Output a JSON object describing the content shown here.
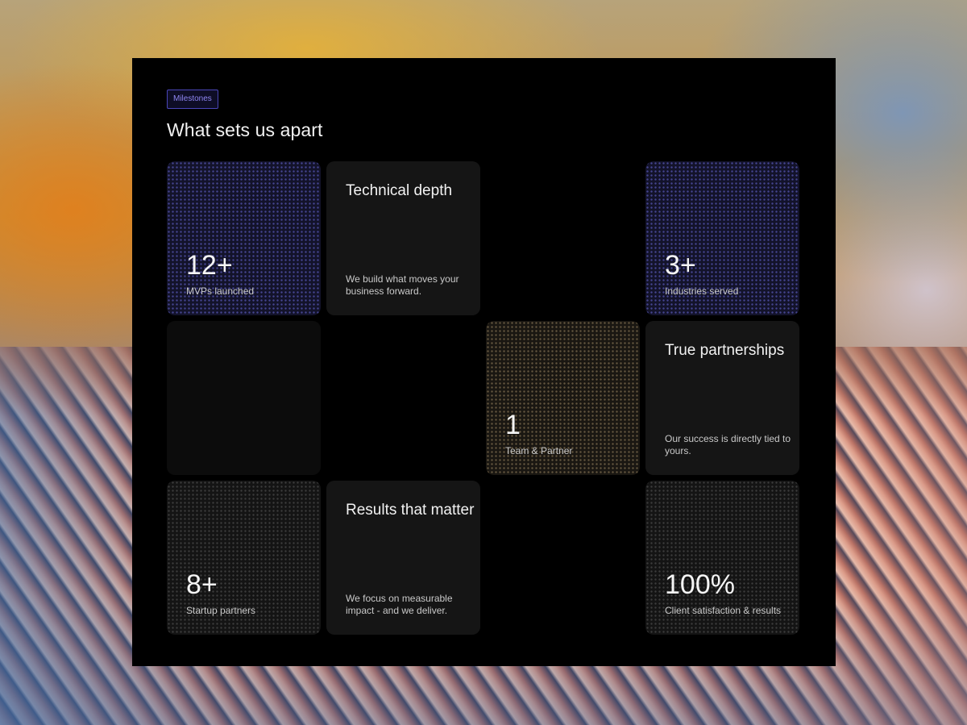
{
  "section": {
    "tag": "Milestones",
    "title": "What sets us apart"
  },
  "cards": {
    "mvps": {
      "value": "12+",
      "label": "MVPs launched"
    },
    "technical": {
      "title": "Technical depth",
      "description": "We build what moves your business forward."
    },
    "industries": {
      "value": "3+",
      "label": "Industries served"
    },
    "team": {
      "value": "1",
      "label": "Team & Partner"
    },
    "partnerships": {
      "title": "True partnerships",
      "description": "Our success is directly tied to yours."
    },
    "startups": {
      "value": "8+",
      "label": "Startup partners"
    },
    "results": {
      "title": "Results that matter",
      "description": "We focus on measurable impact - and we deliver."
    },
    "satisfaction": {
      "value": "100%",
      "label": "Client satisfaction & results"
    }
  },
  "colors": {
    "panel": "#000000",
    "tag_text": "#8f86f2",
    "tag_border": "#4a46b8",
    "card": "#151515"
  }
}
